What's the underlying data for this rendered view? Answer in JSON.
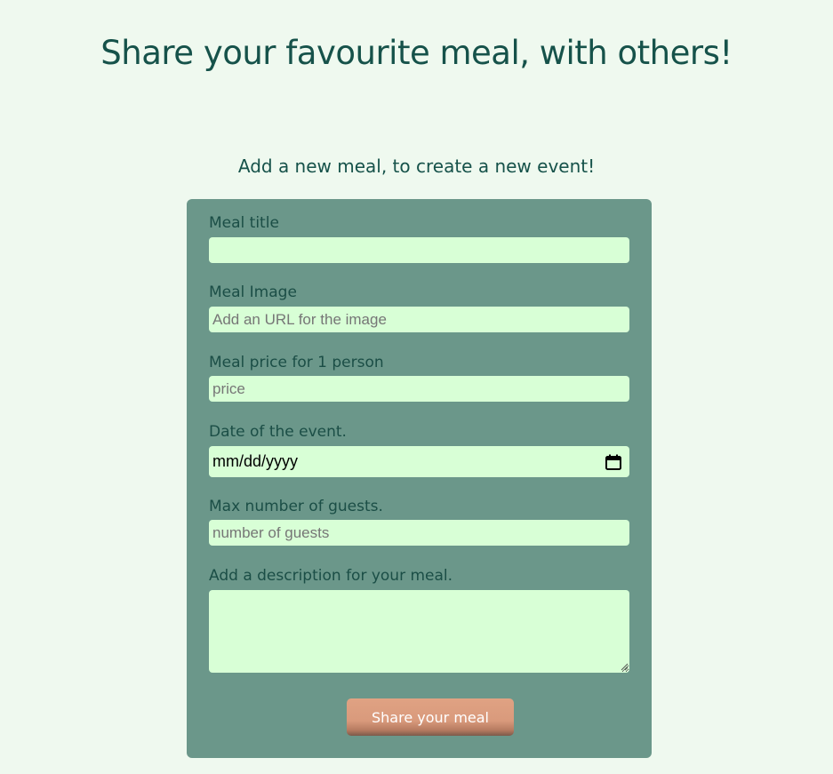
{
  "header": {
    "title": "Share your favourite meal, with others!"
  },
  "form": {
    "section_title": "Add a new meal, to create a new event!",
    "fields": {
      "meal_title": {
        "label": "Meal title",
        "value": "",
        "placeholder": ""
      },
      "meal_image": {
        "label": "Meal Image",
        "value": "",
        "placeholder": "Add an URL for the image"
      },
      "meal_price": {
        "label": "Meal price for 1 person",
        "value": "",
        "placeholder": "price"
      },
      "event_date": {
        "label": "Date of the event.",
        "value": "mm/dd/yyyy",
        "icon": "calendar-icon"
      },
      "max_guests": {
        "label": "Max number of guests.",
        "value": "",
        "placeholder": "number of guests"
      },
      "description": {
        "label": "Add a description for your meal.",
        "value": ""
      }
    },
    "submit_label": "Share your meal"
  },
  "colors": {
    "background": "#eff9ef",
    "card": "#6b978a",
    "input": "#d8ffd6",
    "heading": "#16524a",
    "button": "#e0a283"
  }
}
